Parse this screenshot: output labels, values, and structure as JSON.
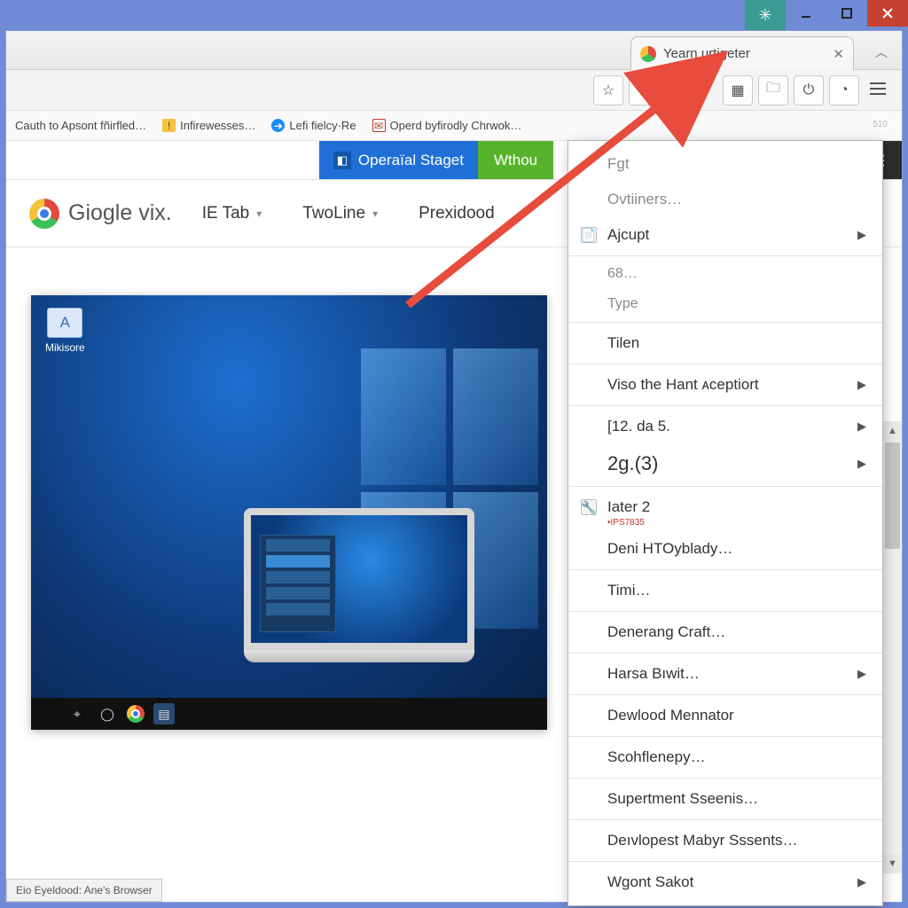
{
  "titlebar": {
    "ext_icon": "✳"
  },
  "tab": {
    "title": "Yearn urtigeter"
  },
  "toolbar": {
    "tiny": "510"
  },
  "bookmarks": [
    {
      "icon_class": "",
      "label": "Cauth to Apsont fñirfled…"
    },
    {
      "icon_class": "yellow",
      "glyph": "!",
      "label": "Infirewesses…"
    },
    {
      "icon_class": "blue",
      "glyph": "➜",
      "label": "Lefi fielcy·Re"
    },
    {
      "icon_class": "mail",
      "glyph": "✉",
      "label": "Operd byfirodly Chrwok…"
    }
  ],
  "sitebar": {
    "blue": "Operaïal Staget",
    "green": "Wthou"
  },
  "brand": "Giogle vix.",
  "nav": [
    {
      "label": "IE Tab",
      "chev": true
    },
    {
      "label": "TwoLine",
      "chev": true
    },
    {
      "label": "Prexidood",
      "chev": false
    }
  ],
  "desktop": {
    "folder_label": "Mikisore"
  },
  "status": "Eio Eyeldood: Ane's Browser",
  "menu": [
    {
      "type": "item",
      "label": "Fgt",
      "dim": true
    },
    {
      "type": "item",
      "label": "Ovtiiners…",
      "dim": true
    },
    {
      "type": "item",
      "label": "Ajcupt",
      "icon": "📄",
      "arrow": true
    },
    {
      "type": "sep"
    },
    {
      "type": "item",
      "label": "68…",
      "dim": true,
      "small": true
    },
    {
      "type": "item",
      "label": "Type",
      "dim": true,
      "small": true
    },
    {
      "type": "sep"
    },
    {
      "type": "item",
      "label": "Tilen"
    },
    {
      "type": "sep"
    },
    {
      "type": "item",
      "label": "Viso the Hant ᴀceptiort",
      "arrow": true
    },
    {
      "type": "sep"
    },
    {
      "type": "item",
      "label": "[12. da 5.",
      "arrow": true
    },
    {
      "type": "item",
      "label": "2g.(3)",
      "big": true,
      "arrow": true
    },
    {
      "type": "sep"
    },
    {
      "type": "item",
      "label": "Iater 2",
      "icon": "🔧"
    },
    {
      "type": "tiny",
      "label": "•IPS7835"
    },
    {
      "type": "item",
      "label": "Deni HTOyblady…"
    },
    {
      "type": "sep"
    },
    {
      "type": "item",
      "label": "Timi…"
    },
    {
      "type": "sep"
    },
    {
      "type": "item",
      "label": "Denerang Craft…"
    },
    {
      "type": "sep"
    },
    {
      "type": "item",
      "label": "Harsa Bıwit…",
      "arrow": true
    },
    {
      "type": "sep"
    },
    {
      "type": "item",
      "label": "Dewlood Mennator"
    },
    {
      "type": "sep"
    },
    {
      "type": "item",
      "label": "Scohflenepy…"
    },
    {
      "type": "sep"
    },
    {
      "type": "item",
      "label": "Supertment Sseenis…"
    },
    {
      "type": "sep"
    },
    {
      "type": "item",
      "label": "Deıvlopest Mabyr Sssents…"
    },
    {
      "type": "sep"
    },
    {
      "type": "item",
      "label": "Wgont Sakot",
      "arrow": true
    }
  ]
}
